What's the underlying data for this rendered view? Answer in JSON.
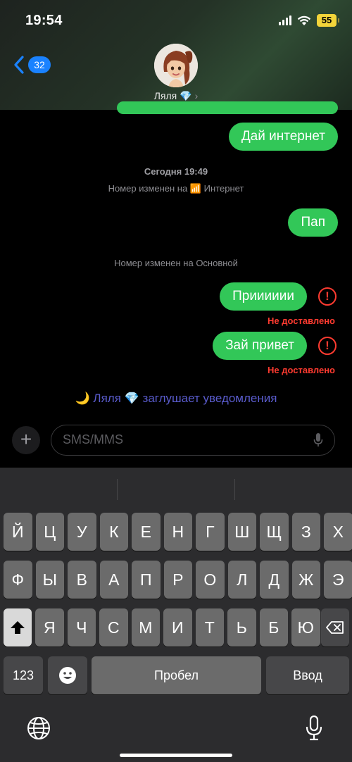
{
  "status": {
    "time": "19:54",
    "battery": "55"
  },
  "header": {
    "back_count": "32",
    "contact_name": "Ляля 💎",
    "chevron": "›"
  },
  "messages": {
    "bubble1": "Дай интернет",
    "timestamp": "Сегодня 19:49",
    "change1_prefix": "Номер изменен на",
    "change1_icon": "📶",
    "change1_value": "Интернет",
    "bubble2": "Пап",
    "change2": "Номер изменен на Основной",
    "bubble3": "Прииииии",
    "error_label": "Не доставлено",
    "bubble4": "Зай привет",
    "error_icon": "!",
    "focus_note": "🌙 Ляля 💎 заглушает уведомления"
  },
  "composer": {
    "plus": "+",
    "placeholder": "SMS/MMS"
  },
  "keyboard": {
    "row1": [
      "Й",
      "Ц",
      "У",
      "К",
      "Е",
      "Н",
      "Г",
      "Ш",
      "Щ",
      "З",
      "Х"
    ],
    "row2": [
      "Ф",
      "Ы",
      "В",
      "А",
      "П",
      "Р",
      "О",
      "Л",
      "Д",
      "Ж",
      "Э"
    ],
    "row3": [
      "Я",
      "Ч",
      "С",
      "М",
      "И",
      "Т",
      "Ь",
      "Б",
      "Ю"
    ],
    "numbers": "123",
    "space": "Пробел",
    "return": "Ввод",
    "icons": [
      "shift-icon",
      "backspace-icon",
      "emoji-icon",
      "globe-icon",
      "mic-icon"
    ]
  },
  "colors": {
    "bubble": "#32c758",
    "error": "#ff3b30",
    "badge": "#1a82ff",
    "focus": "#5a5ccd"
  }
}
